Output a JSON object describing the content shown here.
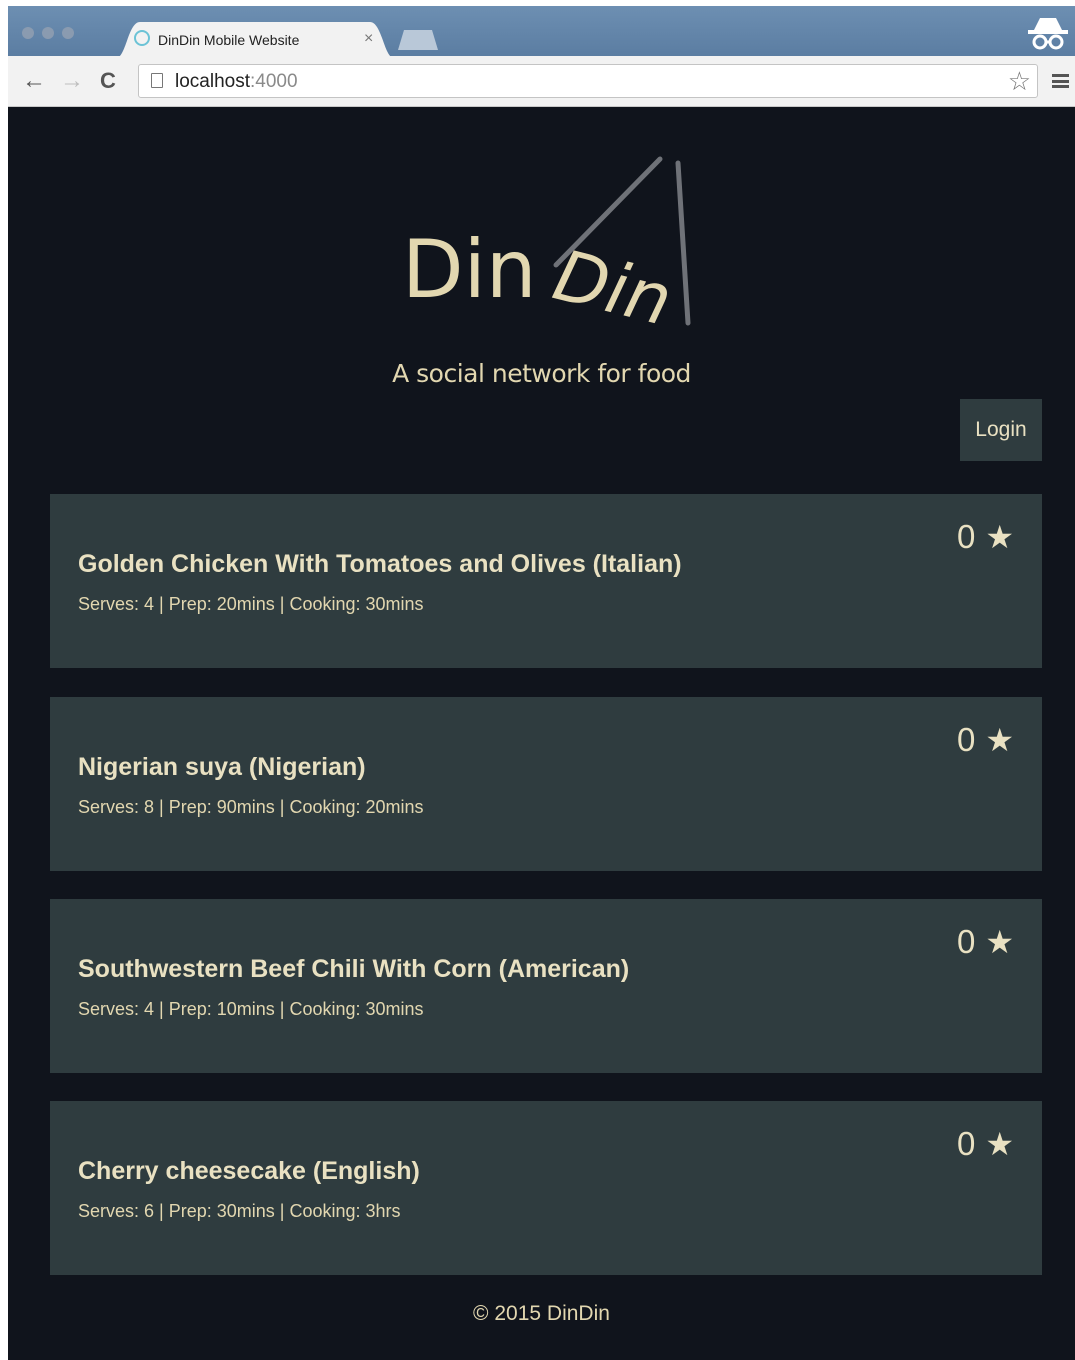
{
  "browser": {
    "tab_title": "DinDin Mobile Website",
    "tab_close": "×",
    "url_host": "localhost",
    "url_port": ":4000",
    "back_icon": "←",
    "forward_icon": "→",
    "reload_icon": "C",
    "bookmark_icon": "☆"
  },
  "header": {
    "logo_text_1": "Din",
    "logo_text_2": "Din",
    "tagline": "A social network for food",
    "login_label": "Login"
  },
  "recipes": [
    {
      "title": "Golden Chicken With Tomatoes and Olives (Italian)",
      "meta": "Serves: 4 | Prep: 20mins | Cooking: 30mins",
      "stars": "0",
      "star_icon": "★"
    },
    {
      "title": "Nigerian suya (Nigerian)",
      "meta": "Serves: 8 | Prep: 90mins | Cooking: 20mins",
      "stars": "0",
      "star_icon": "★"
    },
    {
      "title": "Southwestern Beef Chili With Corn (American)",
      "meta": "Serves: 4 | Prep: 10mins | Cooking: 30mins",
      "stars": "0",
      "star_icon": "★"
    },
    {
      "title": "Cherry cheesecake (English)",
      "meta": "Serves: 6 | Prep: 30mins | Cooking: 3hrs",
      "stars": "0",
      "star_icon": "★"
    }
  ],
  "footer": {
    "copyright": "© 2015 DinDin"
  },
  "colors": {
    "page_bg": "#10141c",
    "card_bg": "#2f3c3f",
    "accent_text": "#e9e1c2"
  }
}
